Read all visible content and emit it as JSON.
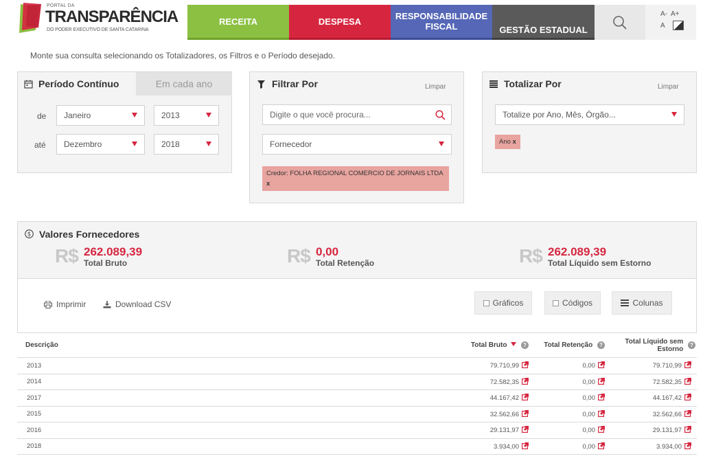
{
  "header": {
    "logo_top": "PORTAL DA",
    "logo_main": "TRANSPARÊNCIA",
    "logo_sub": "DO PODER EXECUTIVO DE SANTA CATARINA",
    "nav": [
      "RECEITA",
      "DESPESA",
      "RESPONSABILIDADE FISCAL",
      "GESTÃO ESTADUAL"
    ],
    "nav_resp_line1": "RESPONSABILIDADE",
    "nav_resp_line2": "FISCAL",
    "font_small": "A-",
    "font_large": "A+",
    "font_normal": "A",
    "colors": {
      "receita": "#8cc043",
      "despesa": "#d6263f",
      "resp": "#5567b6",
      "gestao": "#5a5a5a"
    }
  },
  "intro": "Monte sua consulta selecionando os Totalizadores, os Filtros e o Período desejado.",
  "periodo": {
    "tab_active": "Período Contínuo",
    "tab_inactive": "Em cada ano",
    "de_label": "de",
    "ate_label": "até",
    "de_month": "Janeiro",
    "de_year": "2013",
    "ate_month": "Dezembro",
    "ate_year": "2018"
  },
  "filtrar": {
    "title": "Filtrar Por",
    "limpar": "Limpar",
    "search_placeholder": "Digite o que você procura...",
    "select_value": "Fornecedor",
    "tag": "Credor: FOLHA REGIONAL COMERCIO DE JORNAIS LTDA",
    "tag_remove": "x"
  },
  "totalizar": {
    "title": "Totalizar Por",
    "limpar": "Limpar",
    "select_placeholder": "Totalize por Ano, Mês, Órgão...",
    "tag": "Ano",
    "tag_remove": "x"
  },
  "valores": {
    "title": "Valores Fornecedores",
    "currency": "R$",
    "items": [
      {
        "amount": "262.089,39",
        "label": "Total Bruto"
      },
      {
        "amount": "0,00",
        "label": "Total Retenção"
      },
      {
        "amount": "262.089,39",
        "label": "Total Líquido sem Estorno"
      }
    ]
  },
  "actions": {
    "print": "Imprimir",
    "download": "Download CSV",
    "graficos": "Gráficos",
    "codigos": "Códigos",
    "colunas": "Colunas"
  },
  "table": {
    "headers": [
      "Descrição",
      "Total Bruto",
      "Total Retenção",
      "Total Líquido sem Estorno"
    ],
    "help": "?",
    "rows": [
      [
        "2013",
        "79.710,99",
        "0,00",
        "79.710,99"
      ],
      [
        "2014",
        "72.582,35",
        "0,00",
        "72.582,35"
      ],
      [
        "2017",
        "44.167,42",
        "0,00",
        "44.167,42"
      ],
      [
        "2015",
        "32.562,66",
        "0,00",
        "32.562,66"
      ],
      [
        "2016",
        "29.131,97",
        "0,00",
        "29.131,97"
      ],
      [
        "2018",
        "3.934,00",
        "0,00",
        "3.934,00"
      ]
    ]
  }
}
